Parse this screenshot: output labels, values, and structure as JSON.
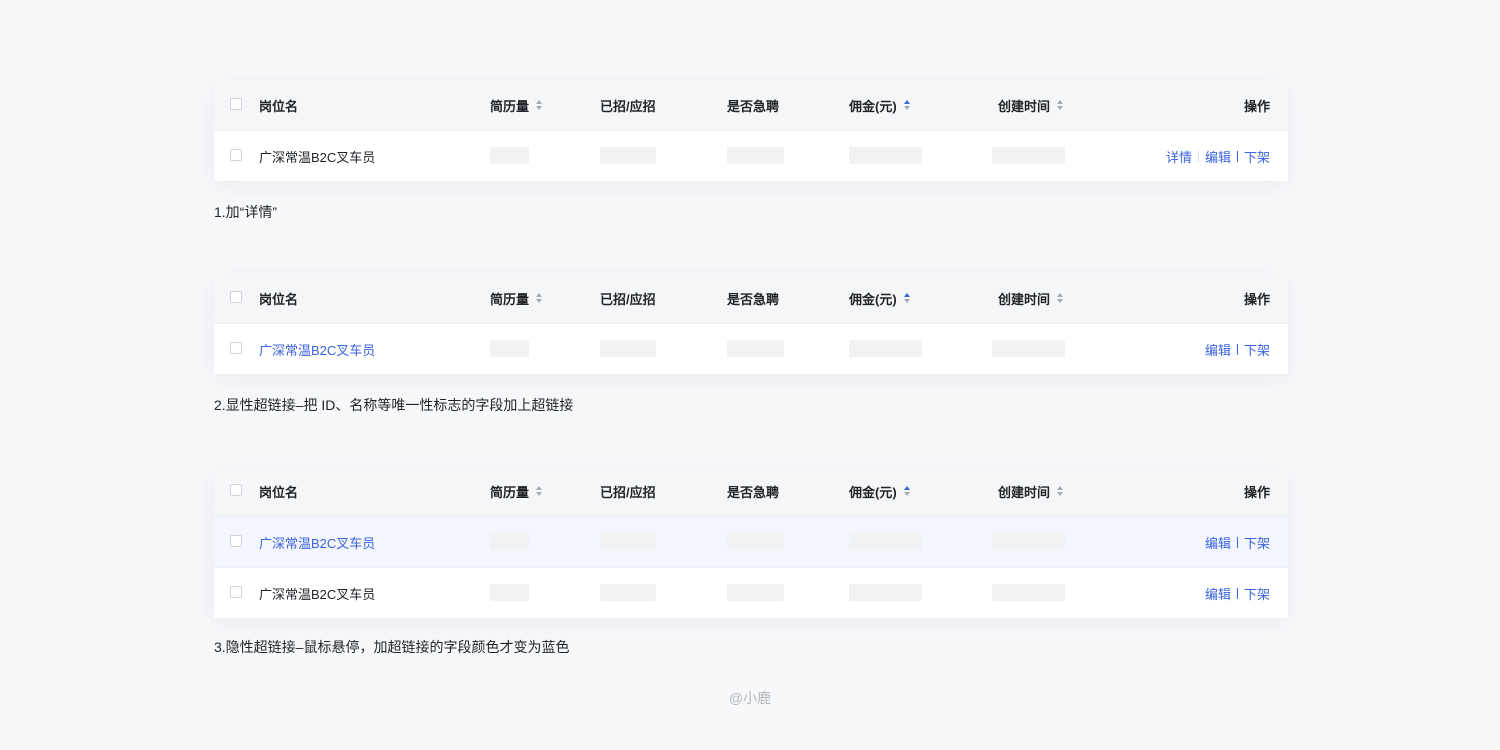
{
  "header": {
    "name": "岗位名",
    "resume": "简历量",
    "hired": "已招/应招",
    "urgent": "是否急聘",
    "commission": "佣金(元)",
    "created": "创建时间",
    "ops": "操作"
  },
  "row_name": "广深常温B2C叉车员",
  "ops": {
    "detail": "详情",
    "edit": "编辑",
    "delist": "下架"
  },
  "captions": {
    "c1": "1.加“详情”",
    "c2": "2.显性超链接–把 ID、名称等唯一性标志的字段加上超链接",
    "c3": "3.隐性超链接–鼠标悬停，加超链接的字段颜色才变为蓝色"
  },
  "credit": "@小鹿",
  "colors": {
    "link": "#3b63e0",
    "header_bg": "#f5f6f8",
    "hover_bg": "#f3f6fd",
    "page_bg": "#f7f8fa"
  },
  "sorted_column": "commission"
}
